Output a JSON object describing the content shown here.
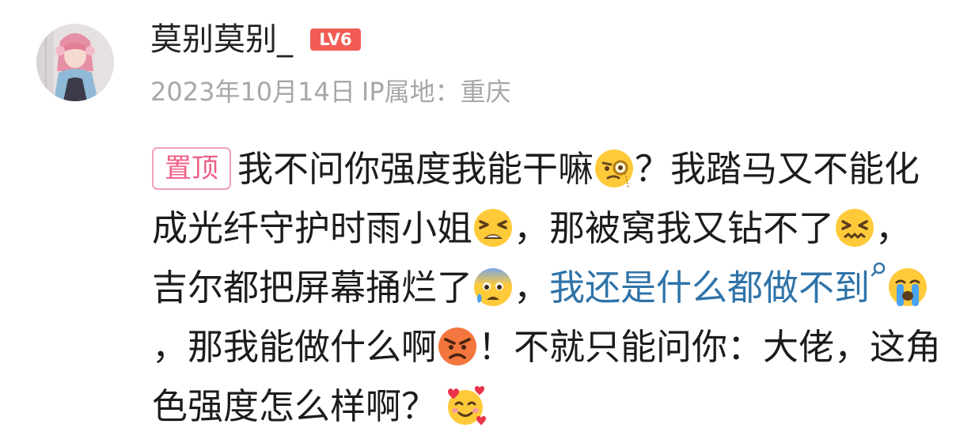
{
  "comment": {
    "username": "莫别莫别_",
    "level_badge": "LV6",
    "date": "2023年10月14日",
    "ip_location": "IP属地：重庆",
    "pin_label": "置顶",
    "segments": {
      "s1": "我不问你强度我能干嘛",
      "s2": "？我踏马又不能化成光纤守护时雨小姐",
      "s3": "，那被窝我又钻不了",
      "s4": "，吉尔都把屏幕捅烂了",
      "s5": "，",
      "link": "我还是什么都做不到",
      "s6": "，那我能做什么啊",
      "s7": "！不就只能问你：大佬，这角色强度怎么样啊？"
    },
    "emojis": {
      "e1": "monocle-face-icon",
      "e2": "tired-face-icon",
      "e3": "confounded-face-icon",
      "e4": "anxious-sweat-face-icon",
      "e5": "crying-face-icon",
      "e6": "angry-face-icon",
      "e7": "smiling-hearts-face-icon"
    }
  },
  "colors": {
    "level_badge_bg": "#f25c54",
    "pin_border": "#f1a1b6",
    "pin_text": "#ef5f86",
    "link_text": "#2f73a8",
    "meta_text": "#a7a7a7"
  }
}
